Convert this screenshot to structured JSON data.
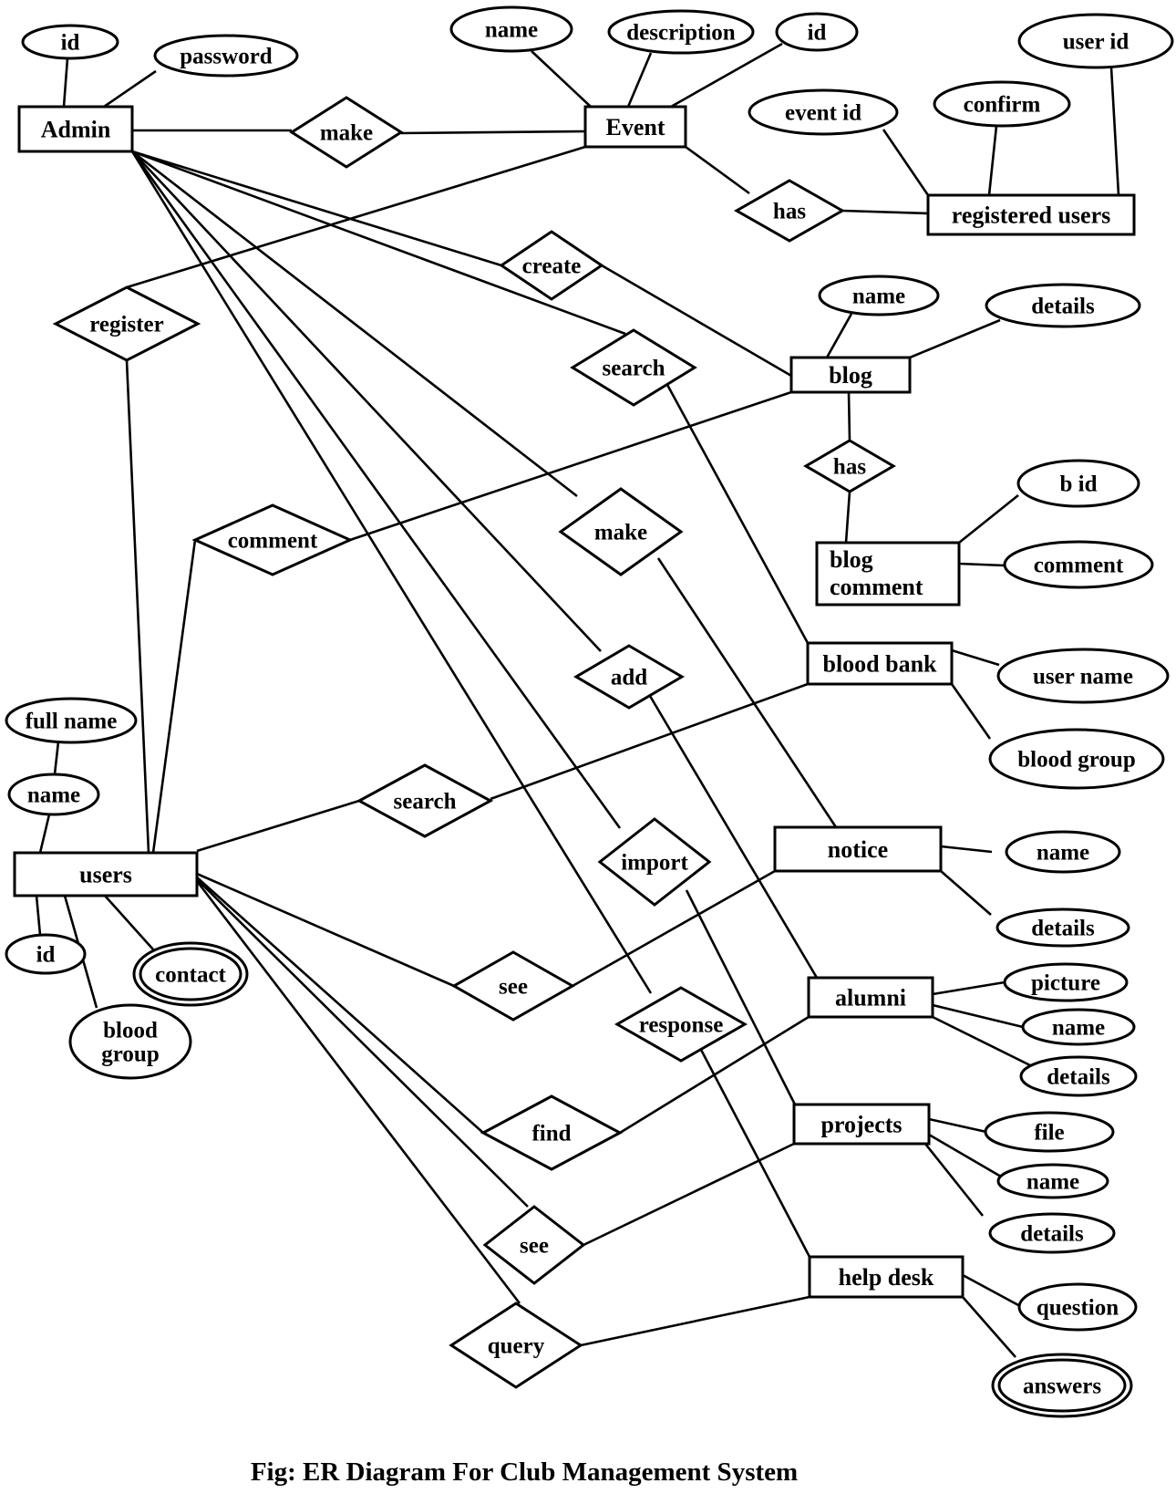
{
  "title": "ER Diagram For Club Management System",
  "caption": "Fig: ER Diagram For Club Management System",
  "colors": {
    "stroke": "#000000",
    "background": "#ffffff"
  },
  "entities": [
    {
      "id": "admin",
      "label": "Admin"
    },
    {
      "id": "event",
      "label": "Event"
    },
    {
      "id": "registered_users",
      "label": "registered users"
    },
    {
      "id": "blog",
      "label": "blog"
    },
    {
      "id": "blog_comment",
      "label": "blog comment"
    },
    {
      "id": "blood_bank",
      "label": "blood bank"
    },
    {
      "id": "users",
      "label": "users"
    },
    {
      "id": "notice",
      "label": "notice"
    },
    {
      "id": "alumni",
      "label": "alumni"
    },
    {
      "id": "projects",
      "label": "projects"
    },
    {
      "id": "help_desk",
      "label": "help desk"
    }
  ],
  "relationships": [
    {
      "id": "r_make_event",
      "label": "make",
      "connects": [
        "admin",
        "event"
      ]
    },
    {
      "id": "r_has_event",
      "label": "has",
      "connects": [
        "event",
        "registered_users"
      ]
    },
    {
      "id": "r_register",
      "label": "register",
      "connects": [
        "event",
        "users"
      ]
    },
    {
      "id": "r_create",
      "label": "create",
      "connects": [
        "admin",
        "blog"
      ]
    },
    {
      "id": "r_search_admin",
      "label": "search",
      "connects": [
        "admin",
        "blood_bank"
      ]
    },
    {
      "id": "r_has_blog",
      "label": "has",
      "connects": [
        "blog",
        "blog_comment"
      ]
    },
    {
      "id": "r_comment",
      "label": "comment",
      "connects": [
        "users",
        "blog"
      ]
    },
    {
      "id": "r_make_notice",
      "label": "make",
      "connects": [
        "admin",
        "notice"
      ]
    },
    {
      "id": "r_add",
      "label": "add",
      "connects": [
        "admin",
        "alumni"
      ]
    },
    {
      "id": "r_search_users",
      "label": "search",
      "connects": [
        "users",
        "blood_bank"
      ]
    },
    {
      "id": "r_import",
      "label": "import",
      "connects": [
        "admin",
        "projects"
      ]
    },
    {
      "id": "r_see_notice",
      "label": "see",
      "connects": [
        "users",
        "notice"
      ]
    },
    {
      "id": "r_response",
      "label": "response",
      "connects": [
        "admin",
        "help_desk"
      ]
    },
    {
      "id": "r_find",
      "label": "find",
      "connects": [
        "users",
        "alumni"
      ]
    },
    {
      "id": "r_see_projects",
      "label": "see",
      "connects": [
        "users",
        "projects"
      ]
    },
    {
      "id": "r_query",
      "label": "query",
      "connects": [
        "users",
        "help_desk"
      ]
    }
  ],
  "attributes": [
    {
      "id": "a_admin_id",
      "label": "id",
      "entity": "admin",
      "multivalued": false
    },
    {
      "id": "a_admin_password",
      "label": "password",
      "entity": "admin",
      "multivalued": false
    },
    {
      "id": "a_event_name",
      "label": "name",
      "entity": "event",
      "multivalued": false
    },
    {
      "id": "a_event_description",
      "label": "description",
      "entity": "event",
      "multivalued": false
    },
    {
      "id": "a_event_id",
      "label": "id",
      "entity": "event",
      "multivalued": false
    },
    {
      "id": "a_ru_event_id",
      "label": "event id",
      "entity": "registered_users",
      "multivalued": false
    },
    {
      "id": "a_ru_confirm",
      "label": "confirm",
      "entity": "registered_users",
      "multivalued": false
    },
    {
      "id": "a_ru_user_id",
      "label": "user id",
      "entity": "registered_users",
      "multivalued": false
    },
    {
      "id": "a_blog_name",
      "label": "name",
      "entity": "blog",
      "multivalued": false
    },
    {
      "id": "a_blog_details",
      "label": "details",
      "entity": "blog",
      "multivalued": false
    },
    {
      "id": "a_bc_bid",
      "label": "b id",
      "entity": "blog_comment",
      "multivalued": false
    },
    {
      "id": "a_bc_comment",
      "label": "comment",
      "entity": "blog_comment",
      "multivalued": false
    },
    {
      "id": "a_bb_user_name",
      "label": "user name",
      "entity": "blood_bank",
      "multivalued": false
    },
    {
      "id": "a_bb_blood_group",
      "label": "blood group",
      "entity": "blood_bank",
      "multivalued": false
    },
    {
      "id": "a_users_full_name",
      "label": "full name",
      "entity": "users",
      "multivalued": false
    },
    {
      "id": "a_users_name",
      "label": "name",
      "entity": "users",
      "multivalued": false
    },
    {
      "id": "a_users_id",
      "label": "id",
      "entity": "users",
      "multivalued": false
    },
    {
      "id": "a_users_blood_group",
      "label": "blood group",
      "entity": "users",
      "multivalued": false
    },
    {
      "id": "a_users_contact",
      "label": "contact",
      "entity": "users",
      "multivalued": true
    },
    {
      "id": "a_notice_name",
      "label": "name",
      "entity": "notice",
      "multivalued": false
    },
    {
      "id": "a_notice_details",
      "label": "details",
      "entity": "notice",
      "multivalued": false
    },
    {
      "id": "a_alumni_picture",
      "label": "picture",
      "entity": "alumni",
      "multivalued": false
    },
    {
      "id": "a_alumni_name",
      "label": "name",
      "entity": "alumni",
      "multivalued": false
    },
    {
      "id": "a_alumni_details",
      "label": "details",
      "entity": "alumni",
      "multivalued": false
    },
    {
      "id": "a_projects_file",
      "label": "file",
      "entity": "projects",
      "multivalued": false
    },
    {
      "id": "a_projects_name",
      "label": "name",
      "entity": "projects",
      "multivalued": false
    },
    {
      "id": "a_projects_details",
      "label": "details",
      "entity": "projects",
      "multivalued": false
    },
    {
      "id": "a_hd_question",
      "label": "question",
      "entity": "help_desk",
      "multivalued": false
    },
    {
      "id": "a_hd_answers",
      "label": "answers",
      "entity": "help_desk",
      "multivalued": true
    }
  ]
}
